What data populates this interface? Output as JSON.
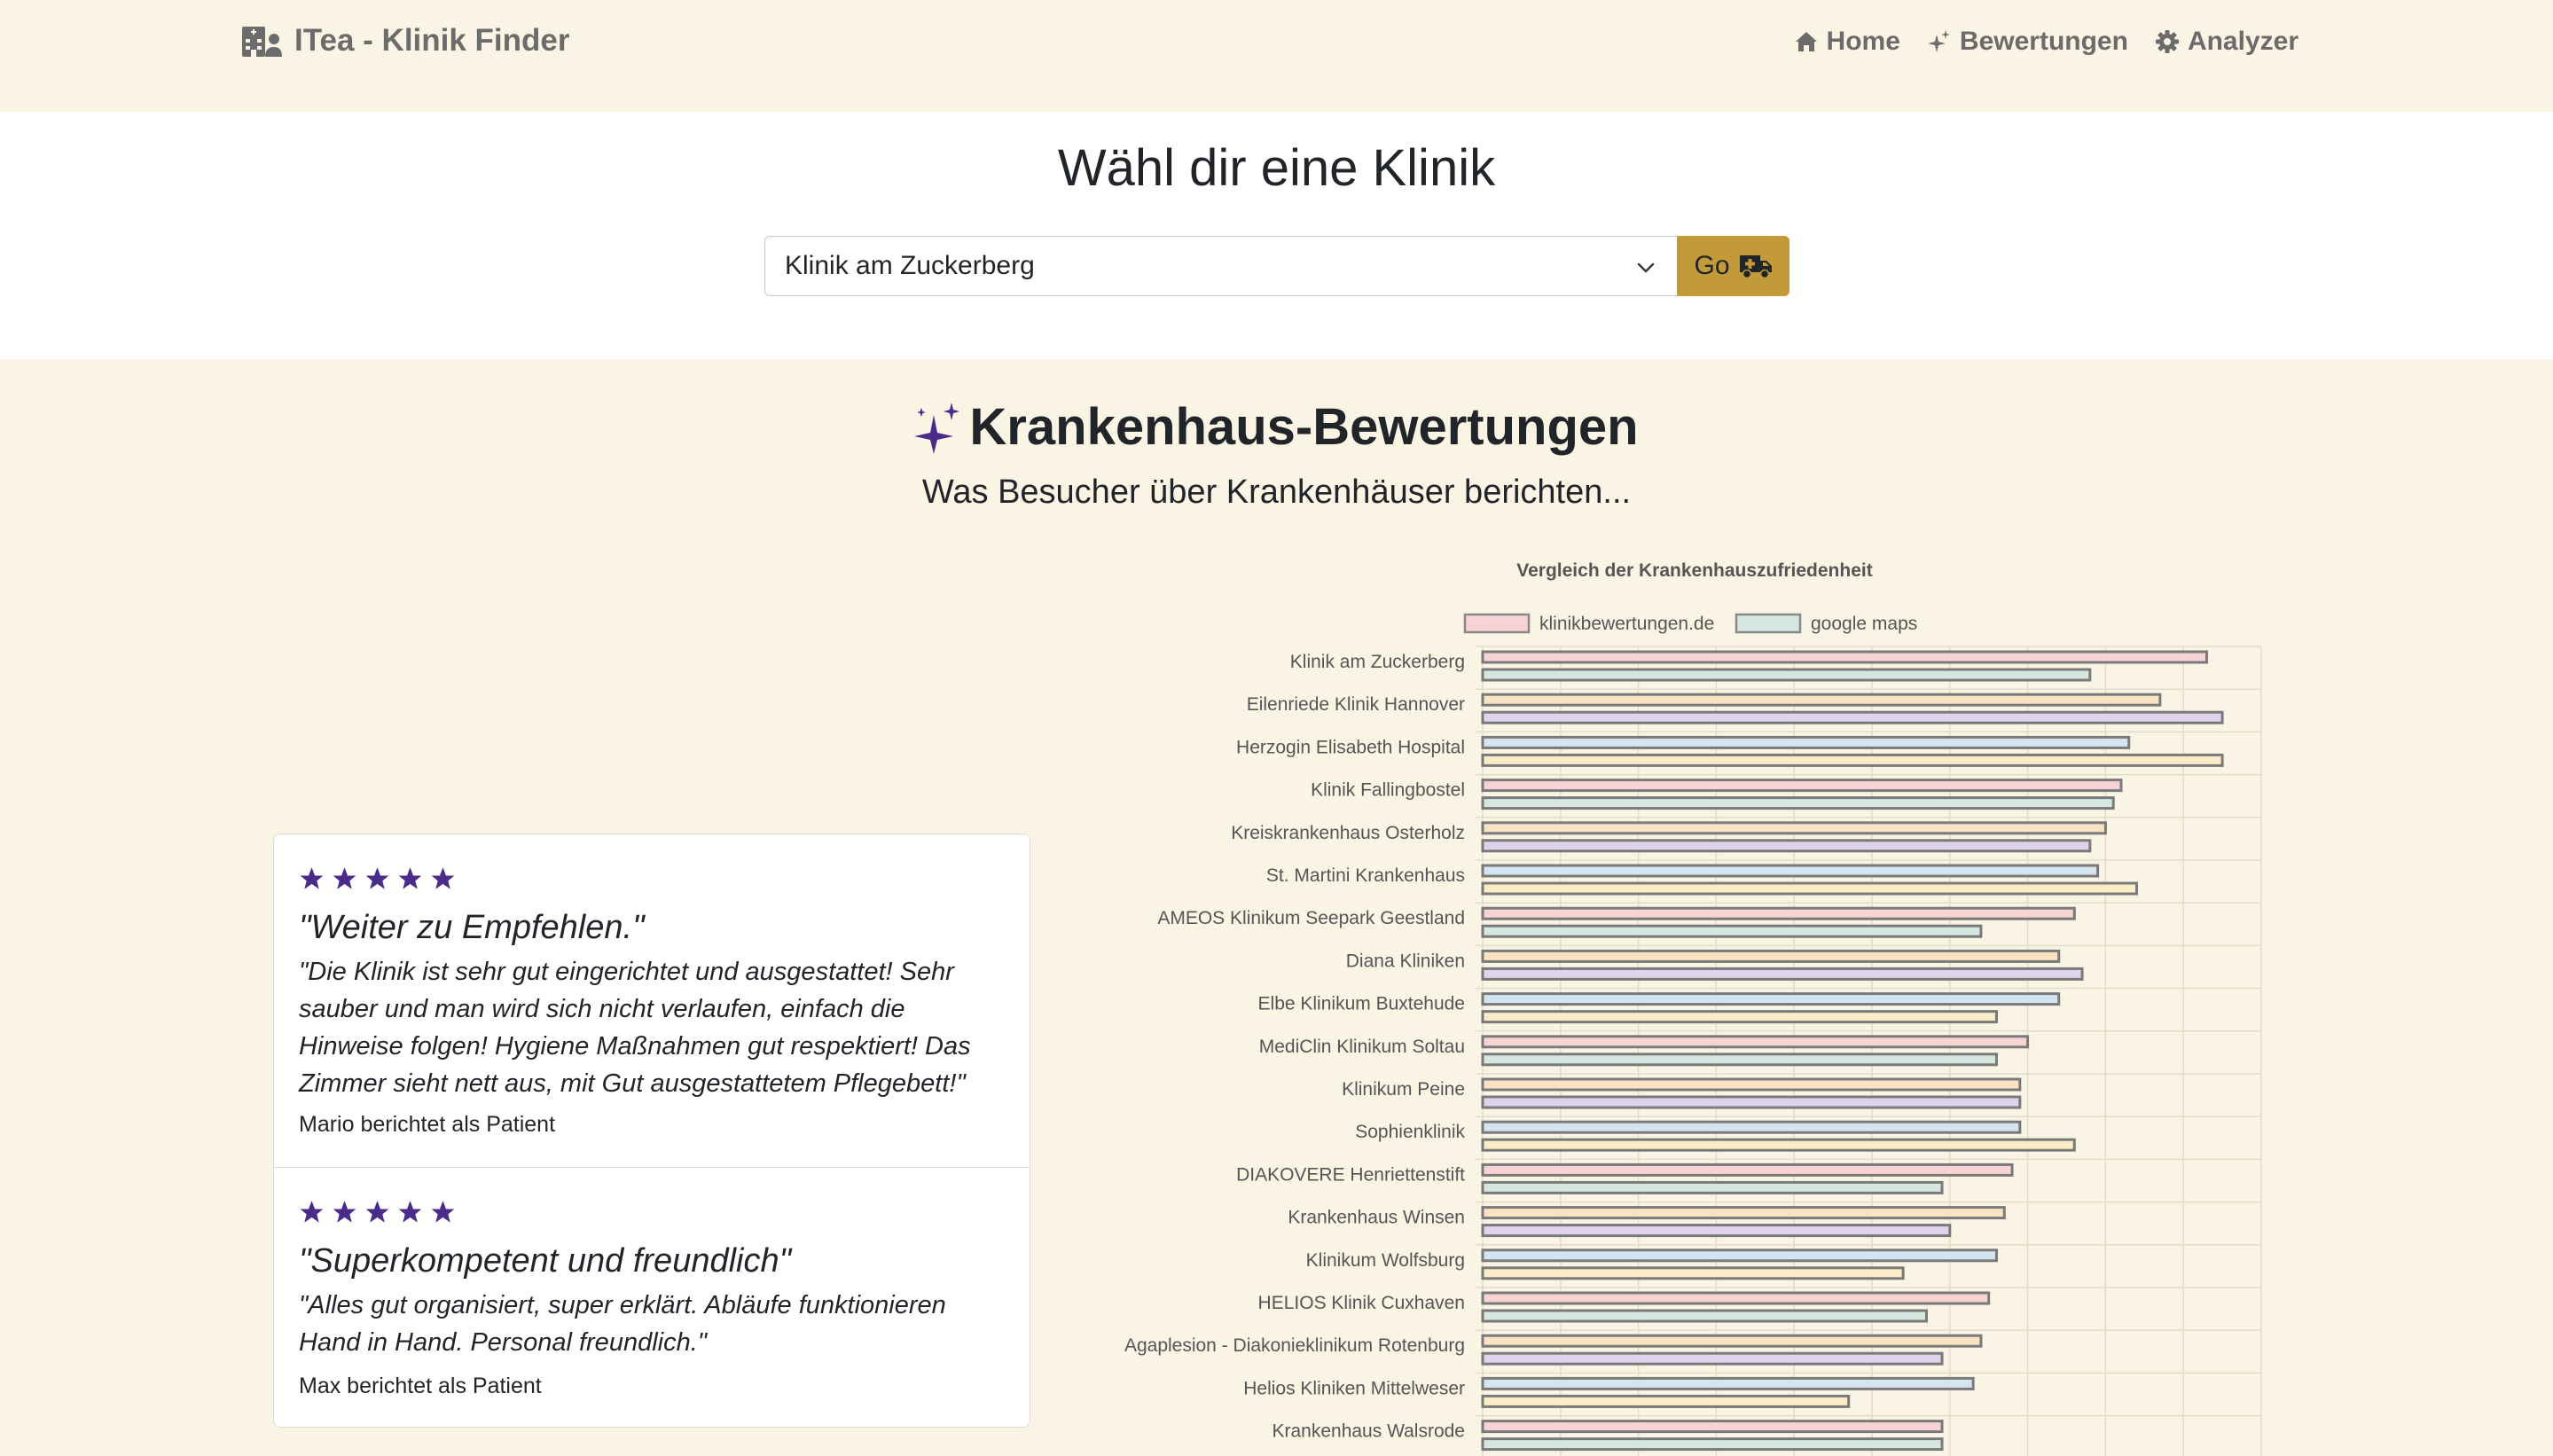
{
  "navbar": {
    "brand": "ITea - Klinik Finder",
    "links": [
      {
        "label": "Home",
        "icon": "house-icon"
      },
      {
        "label": "Bewertungen",
        "icon": "stars-icon"
      },
      {
        "label": "Analyzer",
        "icon": "gear-icon"
      }
    ]
  },
  "select_section": {
    "title": "Wähl dir eine Klinik",
    "selected": "Klinik am Zuckerberg",
    "go_label": "Go"
  },
  "reviews": {
    "title": "Krankenhaus-Bewertungen",
    "subtitle": "Was Besucher über Krankenhäuser berichten...",
    "items": [
      {
        "stars": 5,
        "title": "\"Weiter zu Empfehlen.\"",
        "text_lines": [
          "\"Die Klinik ist sehr gut eingerichtet und ausgestattet! Sehr",
          "sauber und man wird sich nicht verlaufen, einfach die",
          "Hinweise folgen! Hygiene Maßnahmen gut respektiert! Das",
          "Zimmer sieht nett aus, mit Gut ausgestattetem Pflegebett!\""
        ],
        "author": "Mario berichtet als Patient"
      },
      {
        "stars": 5,
        "title": "\"Superkompetent und freundlich\"",
        "text_lines": [
          "\"Alles gut organisiert, super erklärt. Abläufe funktionieren",
          "Hand in Hand. Personal freundlich.\""
        ],
        "author": "Max berichtet als Patient"
      }
    ],
    "star_color": "#4b2a8a"
  },
  "chart_data": {
    "type": "bar",
    "orientation": "horizontal",
    "title": "Vergleich der Krankenhauszufriedenheit",
    "legend_position": "top",
    "legend": [
      {
        "name": "klinikbewertungen.de",
        "fill": "#f7d3d3",
        "stroke": "#8a8a8a"
      },
      {
        "name": "google maps",
        "fill": "#d5e7df",
        "stroke": "#8a8a8a"
      }
    ],
    "grid": true,
    "xlim": [
      0,
      10
    ],
    "categories": [
      "Klinik am Zuckerberg",
      "Eilenriede Klinik Hannover",
      "Herzogin Elisabeth Hospital",
      "Klinik Fallingbostel",
      "Kreiskrankenhaus Osterholz",
      "St. Martini Krankenhaus",
      "AMEOS Klinikum Seepark Geestland",
      "Diana Kliniken",
      "Elbe Klinikum Buxtehude",
      "MediClin Klinikum Soltau",
      "Klinikum Peine",
      "Sophienklinik",
      "DIAKOVERE Henriettenstift",
      "Krankenhaus Winsen",
      "Klinikum Wolfsburg",
      "HELIOS Klinik Cuxhaven",
      "Agaplesion - Diakonieklinikum Rotenburg",
      "Helios Kliniken Mittelweser",
      "Krankenhaus Walsrode"
    ],
    "series": [
      {
        "name": "klinikbewertungen.de",
        "values": [
          9.3,
          8.7,
          8.3,
          8.2,
          8.0,
          7.9,
          7.6,
          7.4,
          7.4,
          7.0,
          6.9,
          6.9,
          6.8,
          6.7,
          6.6,
          6.5,
          6.4,
          6.3,
          5.9
        ]
      },
      {
        "name": "google maps",
        "values": [
          7.8,
          9.5,
          9.5,
          8.1,
          7.8,
          8.4,
          6.4,
          7.7,
          6.6,
          6.6,
          6.9,
          7.6,
          5.9,
          6.0,
          5.4,
          5.7,
          5.9,
          4.7,
          5.9
        ]
      }
    ],
    "bar_colors": [
      "#f7d3d3",
      "#d5e7df",
      "#fae3c3",
      "#e0d4ec",
      "#d4e4f0",
      "#f9ecc6"
    ],
    "bar_stroke": "#7a7a7a"
  }
}
